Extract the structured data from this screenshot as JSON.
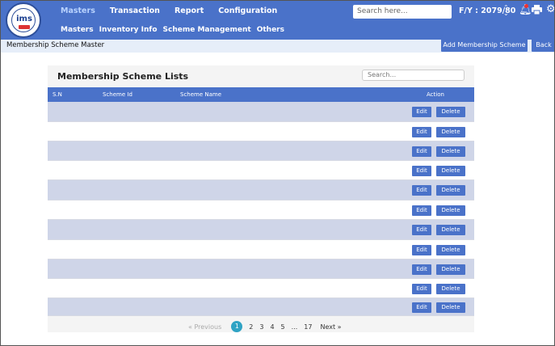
{
  "logo": {
    "text": "ims"
  },
  "nav": {
    "main": [
      "Masters",
      "Transaction",
      "Report",
      "Configuration"
    ],
    "sub": [
      "Masters",
      "Inventory Info",
      "Scheme Management",
      "Others"
    ],
    "search_placeholder": "Search here...",
    "fiscal_year": "F/Y : 2079/80"
  },
  "page": {
    "breadcrumb": "Membership Scheme Master",
    "add_button": "Add Membership Scheme",
    "back_button": "Back"
  },
  "list": {
    "title": "Membership Scheme Lists",
    "search_placeholder": "Search...",
    "columns": [
      "S.N",
      "Scheme Id",
      "Scheme Name",
      "Action"
    ],
    "row_actions": {
      "edit": "Edit",
      "delete": "Delete"
    },
    "row_count": 11
  },
  "pagination": {
    "previous": "« Previous",
    "pages": [
      "1",
      "2",
      "3",
      "4",
      "5",
      "...",
      "17"
    ],
    "active": "1",
    "next": "Next »"
  },
  "colors": {
    "primary": "#4a72c9",
    "row_shade": "#cfd5e8",
    "pagination_active": "#2fa3c4"
  }
}
